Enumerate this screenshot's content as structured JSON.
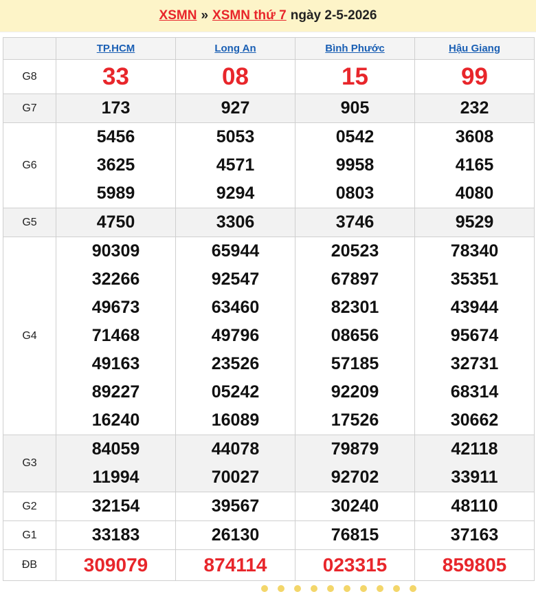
{
  "header": {
    "crumb1": "XSMN",
    "separator": "»",
    "crumb2": "XSMN thứ 7",
    "date": "ngày 2-5-2026"
  },
  "provinces": [
    "TP.HCM",
    "Long An",
    "Bình Phước",
    "Hậu Giang"
  ],
  "prizes": [
    {
      "label": "G8",
      "values": [
        [
          "33"
        ],
        [
          "08"
        ],
        [
          "15"
        ],
        [
          "99"
        ]
      ]
    },
    {
      "label": "G7",
      "values": [
        [
          "173"
        ],
        [
          "927"
        ],
        [
          "905"
        ],
        [
          "232"
        ]
      ]
    },
    {
      "label": "G6",
      "values": [
        [
          "5456",
          "3625",
          "5989"
        ],
        [
          "5053",
          "4571",
          "9294"
        ],
        [
          "0542",
          "9958",
          "0803"
        ],
        [
          "3608",
          "4165",
          "4080"
        ]
      ]
    },
    {
      "label": "G5",
      "values": [
        [
          "4750"
        ],
        [
          "3306"
        ],
        [
          "3746"
        ],
        [
          "9529"
        ]
      ]
    },
    {
      "label": "G4",
      "values": [
        [
          "90309",
          "32266",
          "49673",
          "71468",
          "49163",
          "89227",
          "16240"
        ],
        [
          "65944",
          "92547",
          "63460",
          "49796",
          "23526",
          "05242",
          "16089"
        ],
        [
          "20523",
          "67897",
          "82301",
          "08656",
          "57185",
          "92209",
          "17526"
        ],
        [
          "78340",
          "35351",
          "43944",
          "95674",
          "32731",
          "68314",
          "30662"
        ]
      ]
    },
    {
      "label": "G3",
      "values": [
        [
          "84059",
          "11994"
        ],
        [
          "44078",
          "70027"
        ],
        [
          "79879",
          "92702"
        ],
        [
          "42118",
          "33911"
        ]
      ]
    },
    {
      "label": "G2",
      "values": [
        [
          "32154"
        ],
        [
          "39567"
        ],
        [
          "30240"
        ],
        [
          "48110"
        ]
      ]
    },
    {
      "label": "G1",
      "values": [
        [
          "33183"
        ],
        [
          "26130"
        ],
        [
          "76815"
        ],
        [
          "37163"
        ]
      ]
    },
    {
      "label": "ĐB",
      "values": [
        [
          "309079"
        ],
        [
          "874114"
        ],
        [
          "023315"
        ],
        [
          "859805"
        ]
      ]
    }
  ],
  "colors": {
    "accent_red": "#e8262b",
    "link_blue": "#1a5fb4",
    "header_bg": "#fdf4c8"
  }
}
